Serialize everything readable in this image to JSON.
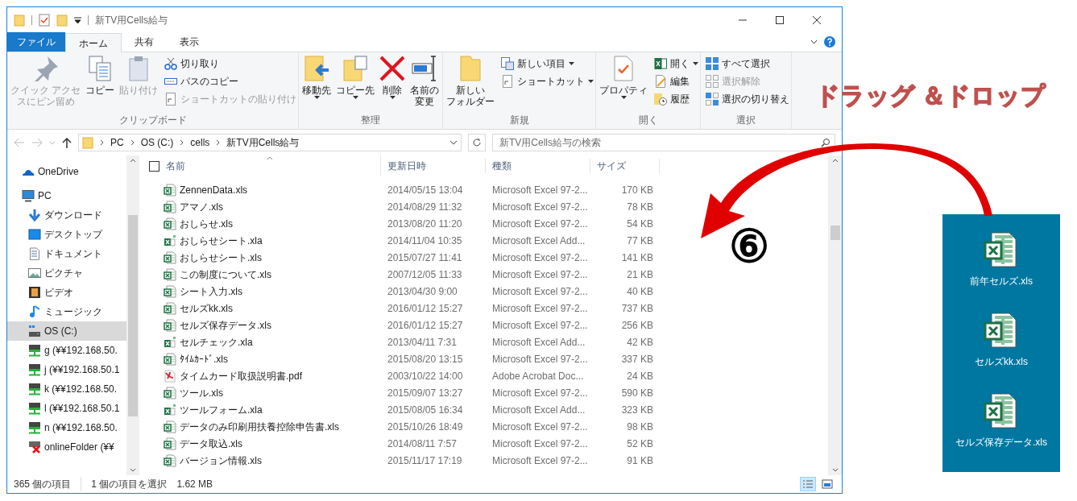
{
  "window": {
    "title": "新TV用Cells給与"
  },
  "tabs": [
    {
      "label": "ファイル",
      "kind": "file",
      "selected": false
    },
    {
      "label": "ホーム",
      "kind": "tab",
      "selected": true
    },
    {
      "label": "共有",
      "kind": "tab",
      "selected": false
    },
    {
      "label": "表示",
      "kind": "tab",
      "selected": false
    }
  ],
  "ribbon_groups": [
    {
      "label": "クリップボード",
      "items": [
        {
          "lines": [
            "クイック アクセ",
            "スにピン留め"
          ],
          "kind": "large",
          "disabled": true
        },
        {
          "lines": [
            "コピー"
          ],
          "kind": "large",
          "disabled": false
        },
        {
          "lines": [
            "貼り付け"
          ],
          "kind": "large",
          "disabled": true
        },
        {
          "kind": "stack",
          "items": [
            {
              "label": "切り取り",
              "disabled": false
            },
            {
              "label": "パスのコピー",
              "disabled": false
            },
            {
              "label": "ショートカットの貼り付け",
              "disabled": true
            }
          ]
        }
      ]
    },
    {
      "label": "整理",
      "items": [
        {
          "lines": [
            "移動先"
          ],
          "kind": "large",
          "disabled": false,
          "dropdown": true
        },
        {
          "lines": [
            "コピー先"
          ],
          "kind": "large",
          "disabled": false,
          "dropdown": true
        },
        {
          "lines": [
            "削除"
          ],
          "kind": "large",
          "disabled": false,
          "dropdown": true
        },
        {
          "lines": [
            "名前の",
            "変更"
          ],
          "kind": "large",
          "disabled": false
        }
      ]
    },
    {
      "label": "新規",
      "items": [
        {
          "lines": [
            "新しい",
            "フォルダー"
          ],
          "kind": "large",
          "disabled": false
        },
        {
          "kind": "stack",
          "items": [
            {
              "label": "新しい項目",
              "disabled": false,
              "dropdown": true
            },
            {
              "label": "ショートカット",
              "disabled": false,
              "dropdown": true
            }
          ]
        }
      ]
    },
    {
      "label": "開く",
      "items": [
        {
          "lines": [
            "プロパティ"
          ],
          "kind": "large",
          "disabled": false,
          "dropdown": true
        },
        {
          "kind": "stack",
          "items": [
            {
              "label": "開く",
              "disabled": false,
              "dropdown": true
            },
            {
              "label": "編集",
              "disabled": false
            },
            {
              "label": "履歴",
              "disabled": false
            }
          ]
        }
      ]
    },
    {
      "label": "選択",
      "items": [
        {
          "kind": "stack",
          "items": [
            {
              "label": "すべて選択",
              "disabled": false
            },
            {
              "label": "選択解除",
              "disabled": true
            },
            {
              "label": "選択の切り替え",
              "disabled": false
            }
          ]
        }
      ]
    }
  ],
  "address_bar": {
    "path": [
      "PC",
      "OS (C:)",
      "cells",
      "新TV用Cells給与"
    ]
  },
  "search": {
    "placeholder": "新TV用Cells給与の検索"
  },
  "nav_pane": {
    "items": [
      {
        "label": "OneDrive",
        "selected": false
      },
      {
        "label": "PC",
        "selected": false,
        "children": [
          {
            "label": "ダウンロード",
            "selected": false
          },
          {
            "label": "デスクトップ",
            "selected": false
          },
          {
            "label": "ドキュメント",
            "selected": false
          },
          {
            "label": "ピクチャ",
            "selected": false
          },
          {
            "label": "ビデオ",
            "selected": false
          },
          {
            "label": "ミュージック",
            "selected": false
          },
          {
            "label": "OS (C:)",
            "selected": true
          },
          {
            "label": "g (¥¥192.168.50.",
            "selected": false
          },
          {
            "label": "j (¥¥192.168.50.1",
            "selected": false
          },
          {
            "label": "k (¥¥192.168.50.",
            "selected": false
          },
          {
            "label": "l (¥¥192.168.50.1",
            "selected": false
          },
          {
            "label": "n (¥¥192.168.50.",
            "selected": false
          },
          {
            "label": "onlineFolder (¥¥",
            "selected": false
          }
        ]
      }
    ]
  },
  "file_list": {
    "select_all_checked": false,
    "columns": [
      "名前",
      "更新日時",
      "種類",
      "サイズ"
    ],
    "rows": [
      {
        "name": "ZennenData.xls",
        "kind": "xls",
        "date": "2014/05/15 13:04",
        "type": "Microsoft Excel 97-2...",
        "size": "170 KB"
      },
      {
        "name": "アマノ.xls",
        "kind": "xls",
        "date": "2014/08/29 11:32",
        "type": "Microsoft Excel 97-2...",
        "size": "78 KB"
      },
      {
        "name": "おしらせ.xls",
        "kind": "xls",
        "date": "2013/08/20 11:20",
        "type": "Microsoft Excel 97-2...",
        "size": "54 KB"
      },
      {
        "name": "おしらせシート.xla",
        "kind": "xla",
        "date": "2014/11/04 10:35",
        "type": "Microsoft Excel Add...",
        "size": "77 KB"
      },
      {
        "name": "おしらせシート.xls",
        "kind": "xls",
        "date": "2015/07/27 11:41",
        "type": "Microsoft Excel 97-2...",
        "size": "141 KB"
      },
      {
        "name": "この制度について.xls",
        "kind": "xls",
        "date": "2007/12/05 11:33",
        "type": "Microsoft Excel 97-2...",
        "size": "21 KB"
      },
      {
        "name": "シート入力.xls",
        "kind": "xls",
        "date": "2013/04/30 9:00",
        "type": "Microsoft Excel 97-2...",
        "size": "40 KB"
      },
      {
        "name": "セルズkk.xls",
        "kind": "xls",
        "date": "2016/01/12 15:27",
        "type": "Microsoft Excel 97-2...",
        "size": "737 KB"
      },
      {
        "name": "セルズ保存データ.xls",
        "kind": "xls",
        "date": "2016/01/12 15:27",
        "type": "Microsoft Excel 97-2...",
        "size": "256 KB"
      },
      {
        "name": "セルチェック.xla",
        "kind": "xla",
        "date": "2013/04/11 7:31",
        "type": "Microsoft Excel Add...",
        "size": "42 KB"
      },
      {
        "name": "ﾀｲﾑｶｰﾄﾞ.xls",
        "kind": "xls",
        "date": "2015/08/20 13:15",
        "type": "Microsoft Excel 97-2...",
        "size": "337 KB"
      },
      {
        "name": "タイムカード取扱説明書.pdf",
        "kind": "pdf",
        "date": "2003/10/22 14:00",
        "type": "Adobe Acrobat Doc...",
        "size": "24 KB"
      },
      {
        "name": "ツール.xls",
        "kind": "xls",
        "date": "2015/09/07 13:27",
        "type": "Microsoft Excel 97-2...",
        "size": "590 KB"
      },
      {
        "name": "ツールフォーム.xla",
        "kind": "xla",
        "date": "2015/08/05 16:34",
        "type": "Microsoft Excel Add...",
        "size": "323 KB"
      },
      {
        "name": "データのみ印刷用扶養控除申告書.xls",
        "kind": "xls",
        "date": "2015/10/26 18:49",
        "type": "Microsoft Excel 97-2...",
        "size": "98 KB"
      },
      {
        "name": "データ取込.xls",
        "kind": "xls",
        "date": "2014/08/11 7:57",
        "type": "Microsoft Excel 97-2...",
        "size": "52 KB"
      },
      {
        "name": "バージョン情報.xls",
        "kind": "xls",
        "date": "2015/11/17 17:19",
        "type": "Microsoft Excel 97-2...",
        "size": "91 KB"
      }
    ]
  },
  "status_bar": {
    "count": "365 個の項目",
    "selection": "1 個の項目を選択",
    "size": "1.62 MB"
  },
  "view_buttons": [
    {
      "selected": true
    },
    {
      "selected": false
    }
  ],
  "overlay": {
    "caption": "ドラッグ ＆ドロップ",
    "step": "⑥"
  },
  "desktop": {
    "files": [
      {
        "name": "前年セルズ.xls"
      },
      {
        "name": "セルズkk.xls"
      },
      {
        "name": "セルズ保存データ.xls"
      }
    ]
  }
}
